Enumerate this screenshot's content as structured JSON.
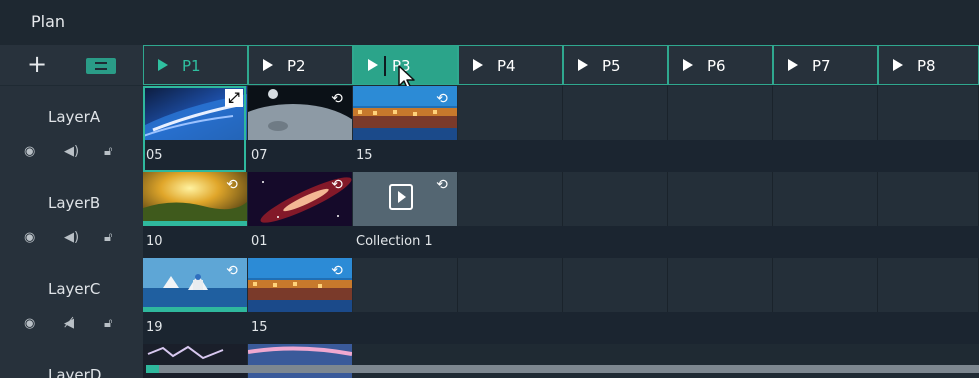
{
  "window": {
    "title": "Plan"
  },
  "toolbar": {
    "add_icon": "plus-icon",
    "collapse_icon": "collapse-icon"
  },
  "programs": [
    {
      "label": "P1"
    },
    {
      "label": "P2"
    },
    {
      "label": "P3"
    },
    {
      "label": "P4"
    },
    {
      "label": "P5"
    },
    {
      "label": "P6"
    },
    {
      "label": "P7"
    },
    {
      "label": "P8"
    }
  ],
  "active_program": "P3",
  "layers": [
    {
      "name": "LayerA",
      "icons": [
        "eye-icon",
        "speaker-icon",
        "lock-icon"
      ],
      "clips": [
        {
          "caption": "05",
          "thumb": "earth-space"
        },
        {
          "caption": "07",
          "thumb": "planet-surface"
        },
        {
          "caption": "15",
          "thumb": "night-town"
        }
      ]
    },
    {
      "name": "LayerB",
      "icons": [
        "eye-icon",
        "speaker-icon",
        "lock-icon"
      ],
      "clips": [
        {
          "caption": "10",
          "thumb": "sunset-landscape"
        },
        {
          "caption": "01",
          "thumb": "galaxy"
        },
        {
          "caption": "Collection 1",
          "thumb": "collection"
        }
      ]
    },
    {
      "name": "LayerC",
      "icons": [
        "eye-icon",
        "speaker-muted-icon",
        "lock-icon"
      ],
      "clips": [
        {
          "caption": "19",
          "thumb": "coastal-village"
        },
        {
          "caption": "15",
          "thumb": "night-town"
        }
      ]
    },
    {
      "name": "LayerD",
      "icons": [],
      "clips": []
    }
  ],
  "colors": {
    "accent": "#2fb89d",
    "background": "#1f2a33",
    "header": "#27313b"
  }
}
